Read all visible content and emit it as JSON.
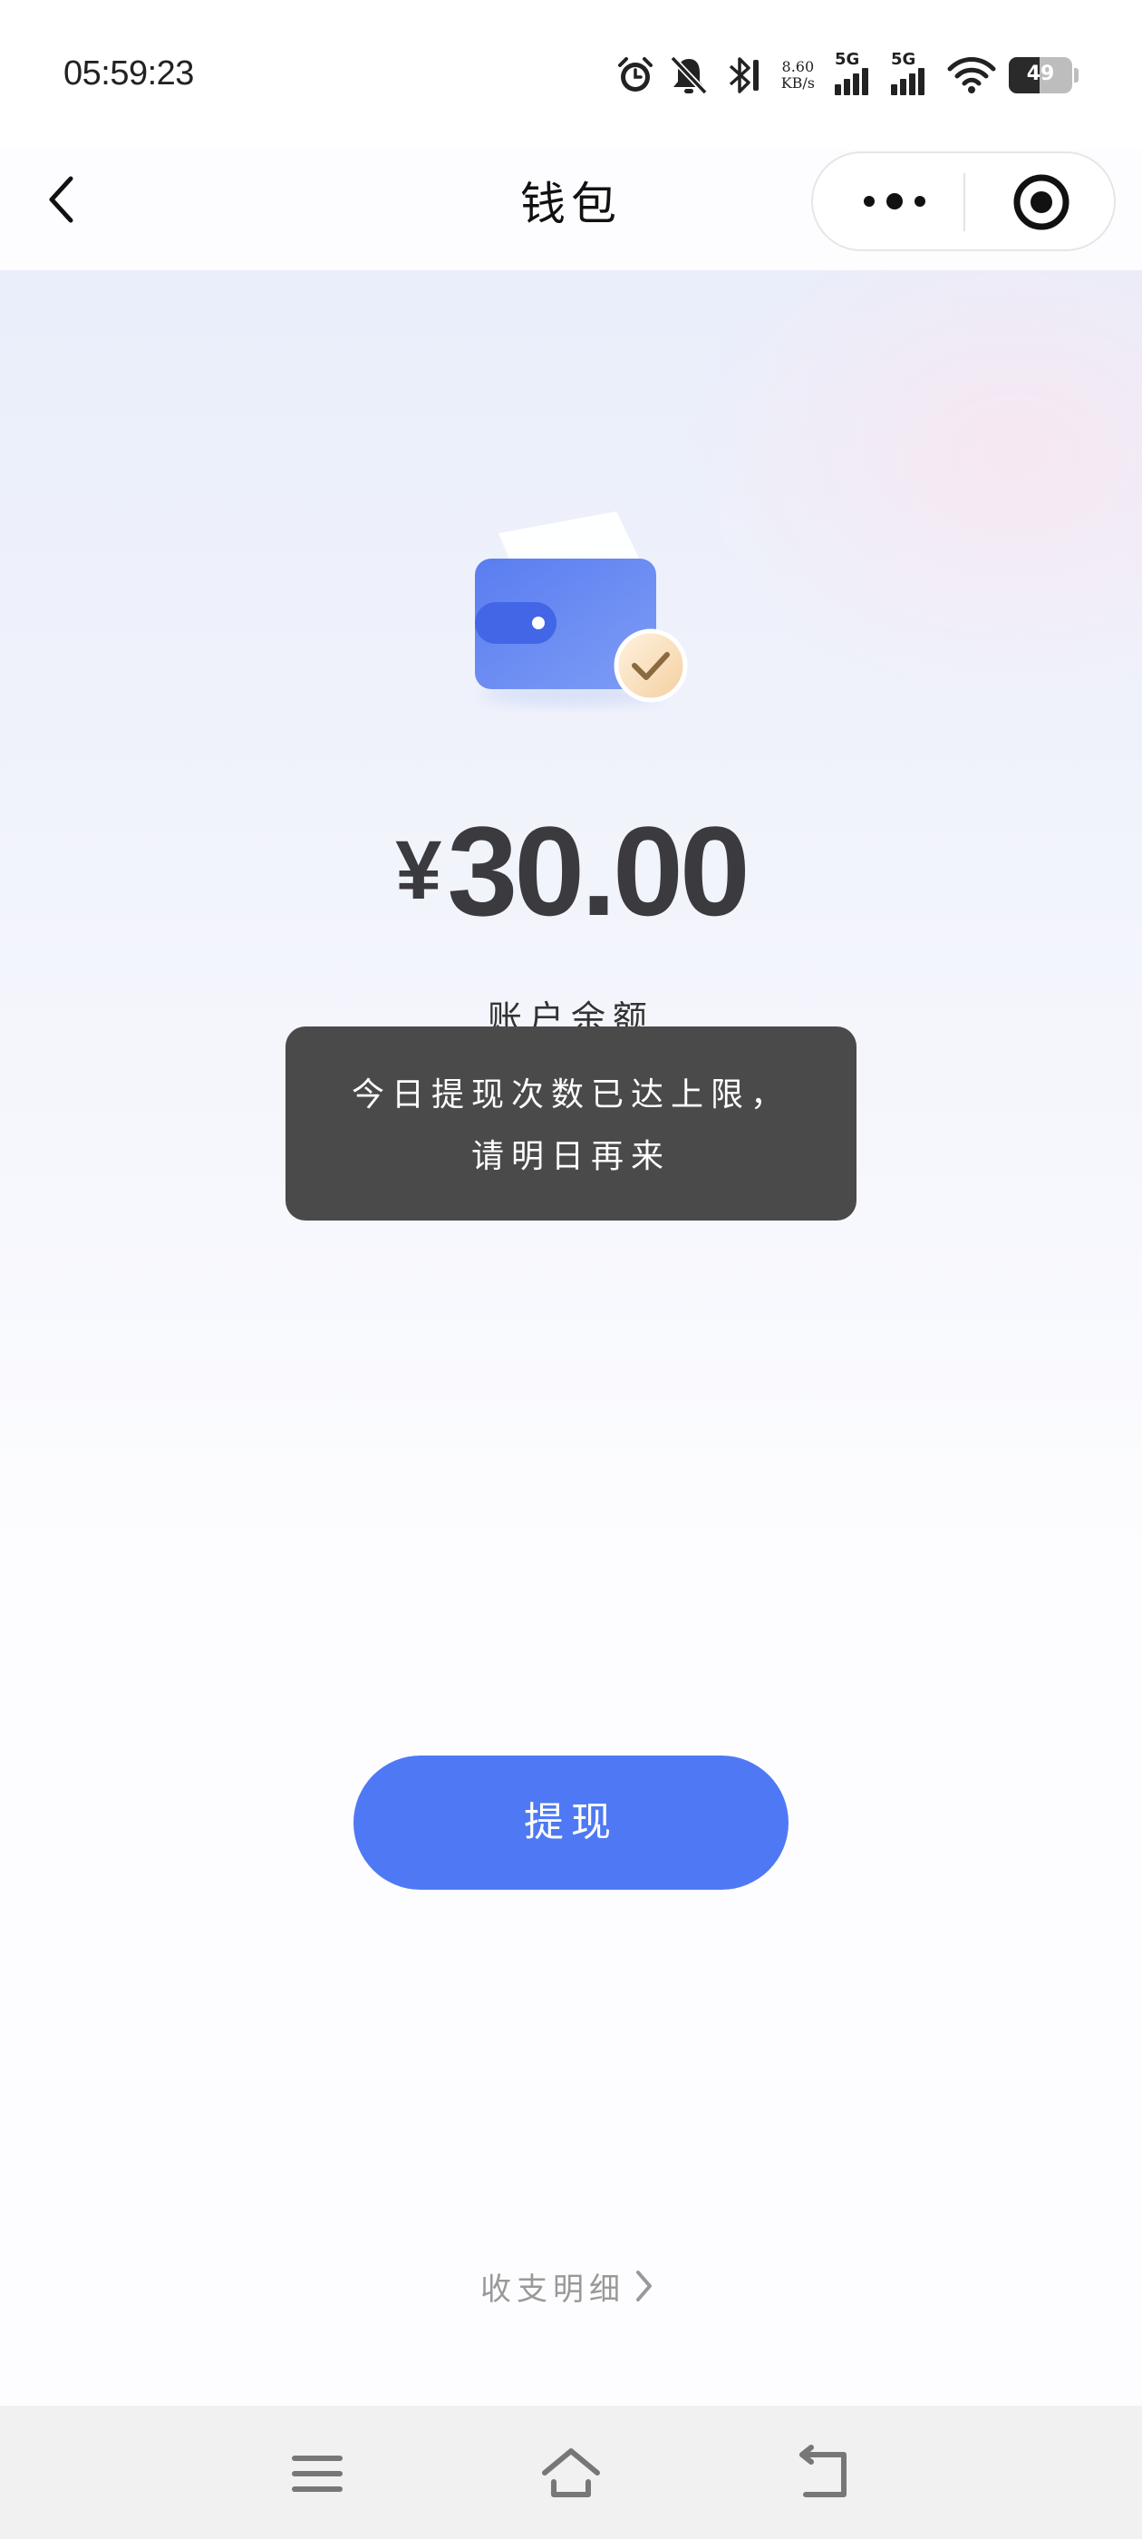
{
  "status_bar": {
    "time": "05:59:23",
    "net_speed_value": "8.60",
    "net_speed_unit": "KB/s",
    "signal_1_label": "5G",
    "signal_2_label": "5G",
    "battery_level": "49",
    "icons": [
      "alarm-icon",
      "mute-icon",
      "bluetooth-icon",
      "signal-icon",
      "wifi-icon",
      "battery-icon"
    ]
  },
  "nav": {
    "title": "钱包",
    "icons": [
      "back-icon",
      "more-icon",
      "target-icon"
    ]
  },
  "wallet": {
    "currency_symbol": "¥",
    "amount": "30.00",
    "balance_label": "账户余额"
  },
  "toast": {
    "line1": "今日提现次数已达上限，",
    "line2": "请明日再来"
  },
  "actions": {
    "withdraw_label": "提现",
    "details_label": "收支明细"
  },
  "colors": {
    "accent": "#4f79f4",
    "toast_bg": "#4a4a4a",
    "amount_text": "#3a3a3f"
  }
}
